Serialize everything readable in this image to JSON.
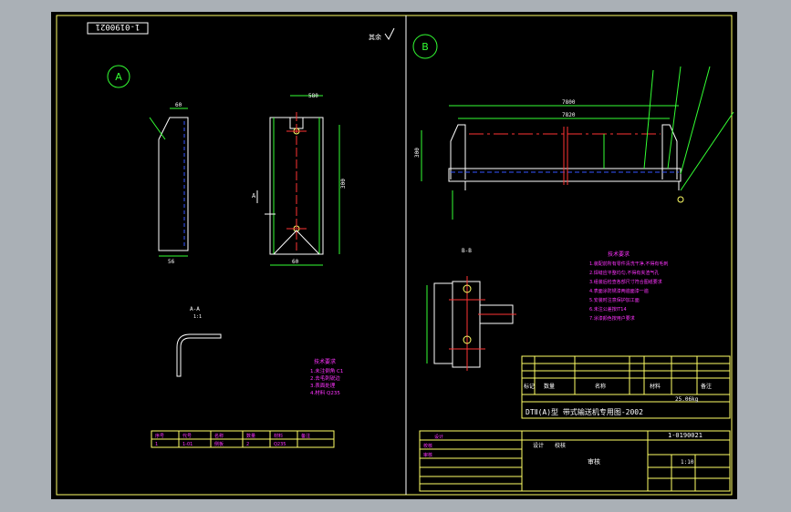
{
  "drawing": {
    "rotated_code": "1-0190021",
    "view_a_label": "A",
    "view_b_label": "B",
    "section_label": "A-A",
    "section_scale": "1:1",
    "detail_label": "B-B",
    "roughness_note": "其余"
  },
  "notes_left": {
    "title": "技术要求",
    "lines": [
      "1.未注倒角 C1",
      "2.去毛刺锐边",
      "3.表面处理",
      "4.材料 Q235"
    ]
  },
  "notes_right": {
    "title": "技术要求",
    "lines": [
      "1.装配前所有零件清洗干净,不得有毛刺",
      "2.焊缝应平整均匀,不得有夹渣气孔",
      "3.组装后检查各部尺寸符合图纸要求",
      "4.表面涂防锈漆两遍面漆一遍",
      "5.安装时注意保护加工面",
      "6.未注公差按IT14",
      "7.涂漆颜色按用户要求"
    ]
  },
  "dims": {
    "total_length": "7800",
    "span": "7820",
    "height": "300",
    "width": "580",
    "plate_width": "60"
  },
  "title_block": {
    "title": "DTⅡ(A)型 带式输送机专用图-2002",
    "drawing_no": "1-0190021",
    "weight": "25.06kg",
    "scale": "1:10",
    "mark": "标记",
    "qty": "数量",
    "name": "名称",
    "material": "材料",
    "remark": "备注",
    "design": "设计",
    "check": "校核",
    "approve": "审核"
  },
  "parts_table": {
    "headers": [
      "序号",
      "代号",
      "名称",
      "数量",
      "材料",
      "备注"
    ],
    "rows": [
      [
        "1",
        "1-01",
        "侧板",
        "2",
        "Q235",
        ""
      ]
    ]
  }
}
